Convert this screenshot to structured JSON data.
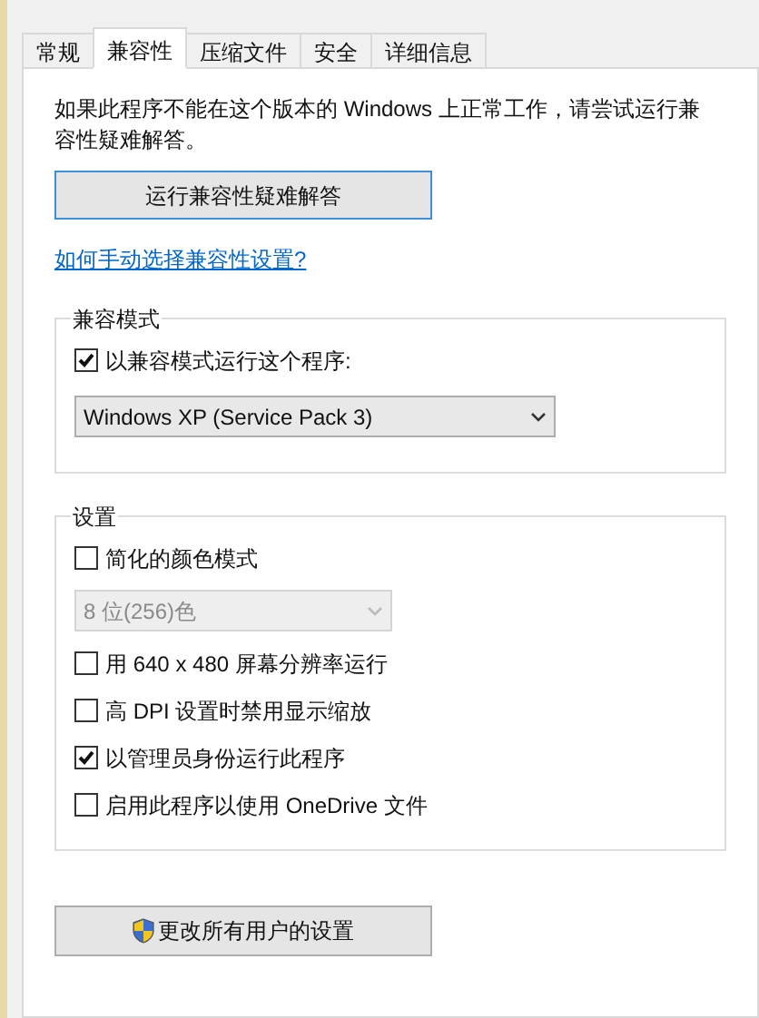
{
  "tabs": [
    {
      "label": "常规",
      "selected": false
    },
    {
      "label": "兼容性",
      "selected": true
    },
    {
      "label": "压缩文件",
      "selected": false
    },
    {
      "label": "安全",
      "selected": false
    },
    {
      "label": "详细信息",
      "selected": false
    }
  ],
  "intro": "如果此程序不能在这个版本的 Windows 上正常工作，请尝试运行兼容性疑难解答。",
  "troubleshoot_button": "运行兼容性疑难解答",
  "manual_link": "如何手动选择兼容性设置?",
  "compat_mode": {
    "title": "兼容模式",
    "checkbox": {
      "label": "以兼容模式运行这个程序:",
      "checked": true
    },
    "select": {
      "value": "Windows XP (Service Pack 3)",
      "disabled": false
    }
  },
  "settings": {
    "title": "设置",
    "items": [
      {
        "kind": "checkbox",
        "label": "简化的颜色模式",
        "checked": false
      },
      {
        "kind": "select",
        "value": "8 位(256)色",
        "disabled": true
      },
      {
        "kind": "checkbox",
        "label": "用 640 x 480 屏幕分辨率运行",
        "checked": false
      },
      {
        "kind": "checkbox",
        "label": "高 DPI 设置时禁用显示缩放",
        "checked": false
      },
      {
        "kind": "checkbox",
        "label": "以管理员身份运行此程序",
        "checked": true
      },
      {
        "kind": "checkbox",
        "label": "启用此程序以使用 OneDrive 文件",
        "checked": false
      }
    ]
  },
  "all_users_button": "更改所有用户的设置"
}
